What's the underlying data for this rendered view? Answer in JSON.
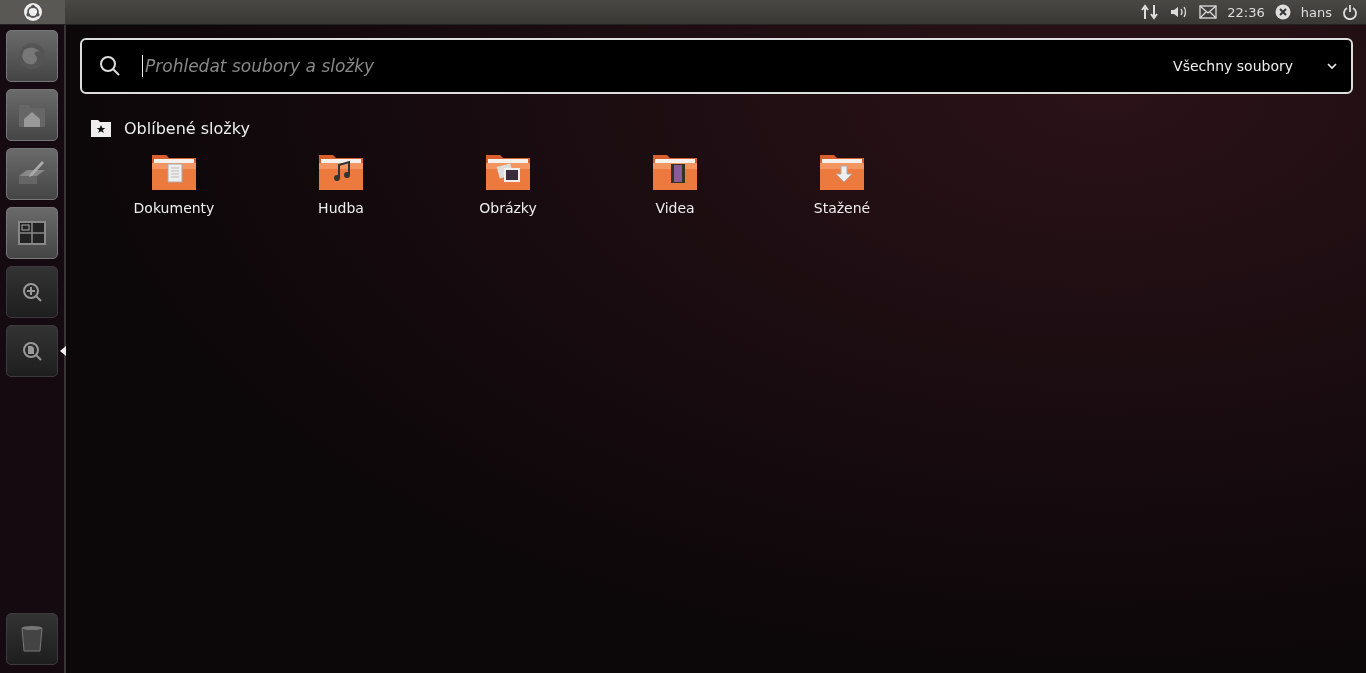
{
  "top_panel": {
    "time": "22:36",
    "user": "hans"
  },
  "launcher": {
    "items": [
      {
        "kind": "browser",
        "active": false
      },
      {
        "kind": "home",
        "active": false
      },
      {
        "kind": "editor",
        "active": false
      },
      {
        "kind": "workspaces",
        "active": false
      },
      {
        "kind": "apps-lens",
        "active": false
      },
      {
        "kind": "files-lens",
        "active": true
      }
    ],
    "trash": {
      "kind": "trash"
    }
  },
  "search": {
    "placeholder": "Prohledat soubory a složky",
    "filter": "Všechny soubory"
  },
  "section": {
    "title": "Oblíbené složky",
    "folders": [
      {
        "label": "Dokumenty",
        "kind": "documents"
      },
      {
        "label": "Hudba",
        "kind": "music"
      },
      {
        "label": "Obrázky",
        "kind": "pictures"
      },
      {
        "label": "Videa",
        "kind": "videos"
      },
      {
        "label": "Stažené",
        "kind": "downloads"
      }
    ]
  }
}
